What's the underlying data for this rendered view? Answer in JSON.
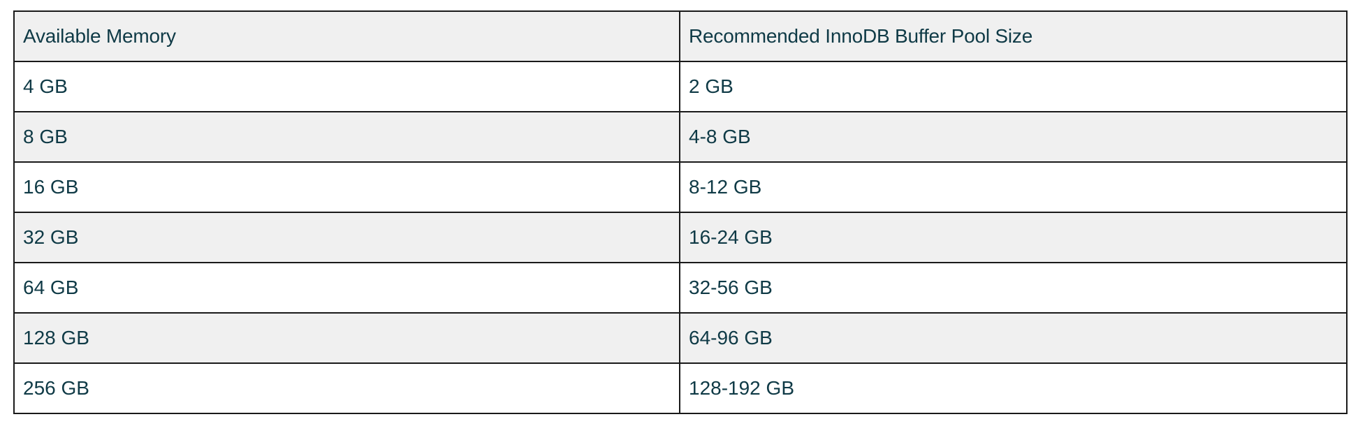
{
  "table": {
    "headers": [
      "Available Memory",
      "Recommended InnoDB Buffer Pool Size"
    ],
    "rows": [
      [
        "4 GB",
        "2 GB"
      ],
      [
        "8 GB",
        "4-8 GB"
      ],
      [
        "16 GB",
        "8-12 GB"
      ],
      [
        "32 GB",
        "16-24 GB"
      ],
      [
        "64 GB",
        "32-56 GB"
      ],
      [
        "128 GB",
        "64-96 GB"
      ],
      [
        "256 GB",
        "128-192 GB"
      ]
    ]
  },
  "colors": {
    "text": "#0f3a46",
    "header_bg": "#f0f0f0",
    "stripe_bg": "#f0f0f0",
    "border": "#1a1a1a"
  }
}
